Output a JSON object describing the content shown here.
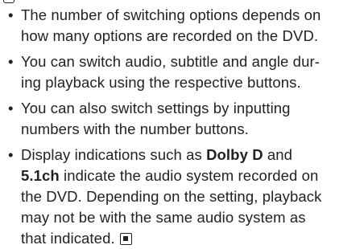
{
  "notes": [
    {
      "bullet": "•",
      "lines": [
        "The number of switching options depends on",
        "how many options are recorded on the DVD."
      ]
    },
    {
      "bullet": "•",
      "lines": [
        "You can switch audio, subtitle and angle dur-",
        "ing playback using the respective buttons."
      ]
    },
    {
      "bullet": "•",
      "lines": [
        "You can also switch settings by inputting",
        "numbers with the number buttons."
      ]
    },
    {
      "bullet": "•",
      "line1_prefix": "Display indications such as ",
      "line1_bold": "Dolby D",
      "line1_suffix": " and",
      "line2_bold": "5.1ch",
      "line2_suffix": " indicate the audio system recorded on",
      "line3": "the DVD. Depending on the setting, playback",
      "line4": "may not be with the same audio system as",
      "line5": "that indicated."
    }
  ],
  "icons": {
    "end_mark": "end-of-section-icon",
    "top_mark": "section-continuation-icon"
  }
}
